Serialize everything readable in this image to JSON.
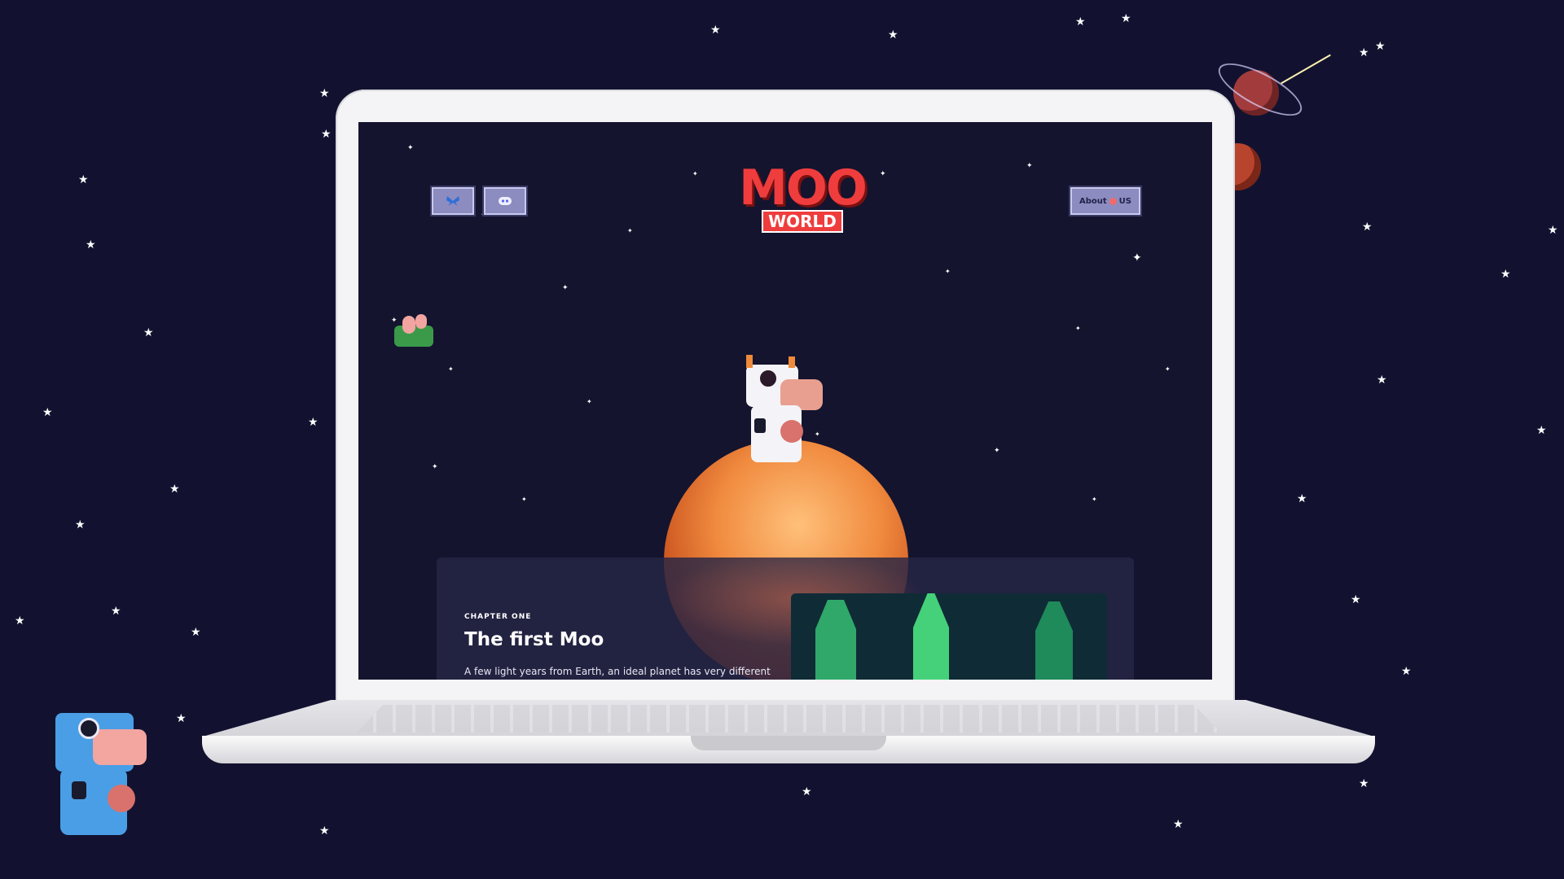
{
  "site": {
    "logo_top": "MOO",
    "logo_bottom": "WORLD"
  },
  "nav": {
    "left_buttons": [
      {
        "name": "bluesky-link",
        "icon": "butterfly-icon"
      },
      {
        "name": "discord-link",
        "icon": "discord-icon"
      }
    ],
    "about": {
      "pre": "About",
      "post": "US",
      "icon": "planet-icon"
    }
  },
  "chapter": {
    "kicker": "CHAPTER ONE",
    "title": "The first Moo",
    "text": "A few light years from Earth, an ideal planet has very different"
  },
  "colors": {
    "space": "#121230",
    "logo_red": "#ef3d3d",
    "button_fill": "#8c8cc0",
    "planet_orange": "#f08a3e"
  }
}
